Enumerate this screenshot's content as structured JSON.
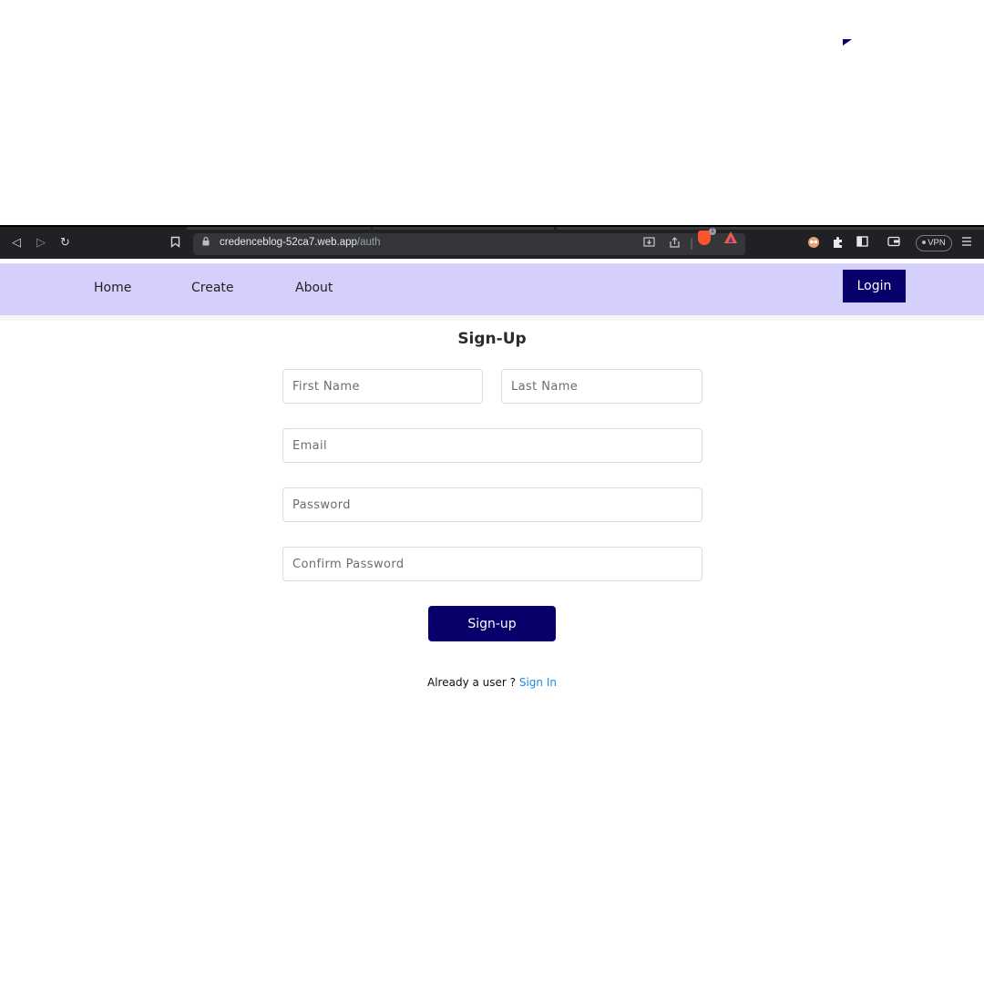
{
  "browser": {
    "url_host": "credenceblog-52ca7.web.app",
    "url_path": "/auth",
    "vpn_label": "VPN",
    "brave_badge": "1"
  },
  "nav": {
    "links": [
      "Home",
      "Create",
      "About"
    ],
    "login_label": "Login"
  },
  "form": {
    "title": "Sign-Up",
    "first_name_placeholder": "First Name",
    "last_name_placeholder": "Last Name",
    "email_placeholder": "Email",
    "password_placeholder": "Password",
    "confirm_password_placeholder": "Confirm Password",
    "submit_label": "Sign-up",
    "already_text": "Already a user ? ",
    "signin_label": "Sign In"
  },
  "colors": {
    "nav_bg": "#d4d0fb",
    "primary": "#07006b",
    "link": "#1e88e5"
  }
}
